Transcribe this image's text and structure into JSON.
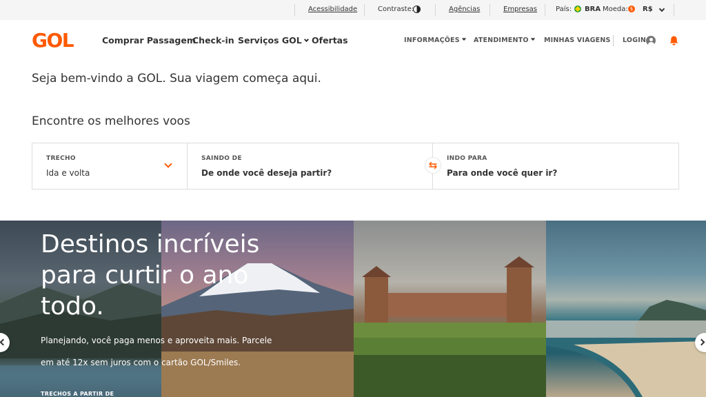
{
  "utility_bar": {
    "accessibility": "Acessibilidade",
    "contrast_label": "Contraste:",
    "agencies": "Agências",
    "companies": "Empresas",
    "country_label": "País:",
    "country_value": "BRA",
    "currency_label": "Moeda:",
    "currency_value": "R$"
  },
  "header": {
    "logo": "GOL",
    "nav_main": [
      "Comprar Passagem",
      "Check-in",
      "Serviços GOL",
      "Ofertas"
    ],
    "nav_secondary": [
      "INFORMAÇÕES",
      "ATENDIMENTO",
      "MINHAS VIAGENS"
    ],
    "login": "LOGIN"
  },
  "main": {
    "welcome": "Seja bem-vindo a GOL. Sua viagem começa aqui.",
    "find_flights": "Encontre os melhores voos"
  },
  "search": {
    "trecho_label": "TRECHO",
    "trecho_value": "Ida e volta",
    "from_label": "SAINDO DE",
    "from_placeholder": "De onde você deseja partir?",
    "to_label": "INDO PARA",
    "to_placeholder": "Para onde você quer ir?"
  },
  "hero": {
    "title": "Destinos incríveis para curtir o ano todo.",
    "text": "Planejando, você paga menos e aproveita mais. Parcele em até 12x sem juros com o cartão GOL/Smiles.",
    "small": "TRECHOS A PARTIR DE"
  },
  "colors": {
    "brand": "#ff5a00",
    "text": "#333333"
  },
  "icons": [
    "contrast-icon",
    "brazil-flag-icon",
    "currency-icon",
    "user-icon",
    "bell-icon",
    "chevron-down-icon",
    "swap-icon",
    "arrow-left-icon",
    "arrow-right-icon"
  ]
}
